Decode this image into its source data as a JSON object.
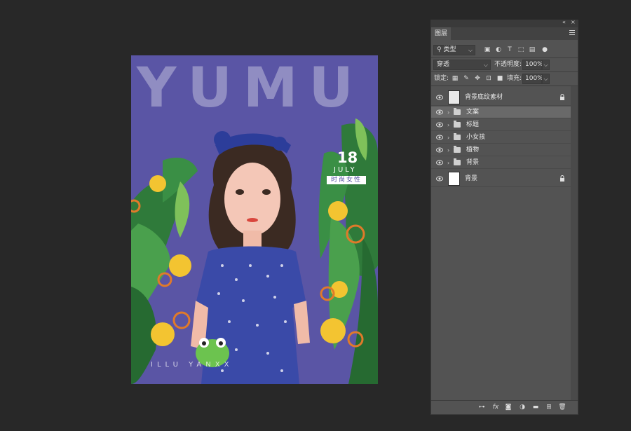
{
  "canvas": {
    "title_text": "YUMU",
    "day": "18",
    "month": "JULY",
    "tag": "时尚女性",
    "footer": "ILLU        YANXX"
  },
  "panel": {
    "collapse_glyph": "«",
    "close_glyph": "×",
    "tab_label": "图层",
    "filter_label": "类型",
    "blend_mode": "穿透",
    "opacity_label": "不透明度:",
    "opacity_value": "100%",
    "lock_label": "锁定:",
    "fill_label": "填充:",
    "fill_value": "100%"
  },
  "layers": [
    {
      "name": "背景底纹素材",
      "kind": "image",
      "locked": true,
      "selected": false
    },
    {
      "name": "文案",
      "kind": "group",
      "locked": false,
      "selected": true
    },
    {
      "name": "标题",
      "kind": "group",
      "locked": false,
      "selected": false
    },
    {
      "name": "小女孩",
      "kind": "group",
      "locked": false,
      "selected": false
    },
    {
      "name": "植物",
      "kind": "group",
      "locked": false,
      "selected": false
    },
    {
      "name": "背景",
      "kind": "group",
      "locked": false,
      "selected": false
    },
    {
      "name": "背景",
      "kind": "image",
      "locked": true,
      "selected": false
    }
  ],
  "icons": {
    "filter_icons": [
      "image-filter-icon",
      "adjustment-filter-icon",
      "type-filter-icon",
      "shape-filter-icon",
      "smart-object-filter-icon",
      "filter-toggle-icon"
    ],
    "lock_icons": [
      "lock-transparent-icon",
      "lock-brush-icon",
      "lock-move-icon",
      "lock-artboard-icon",
      "lock-all-icon"
    ],
    "bottom_icons": [
      "link-layers-icon",
      "fx-icon",
      "mask-icon",
      "adjustment-layer-icon",
      "new-group-icon",
      "new-layer-icon",
      "delete-icon"
    ],
    "fx_text": "fx"
  },
  "colors": {
    "background": "#282828",
    "panel": "#535353",
    "canvas_purple": "#5a55a5",
    "selected_row": "#696969"
  }
}
